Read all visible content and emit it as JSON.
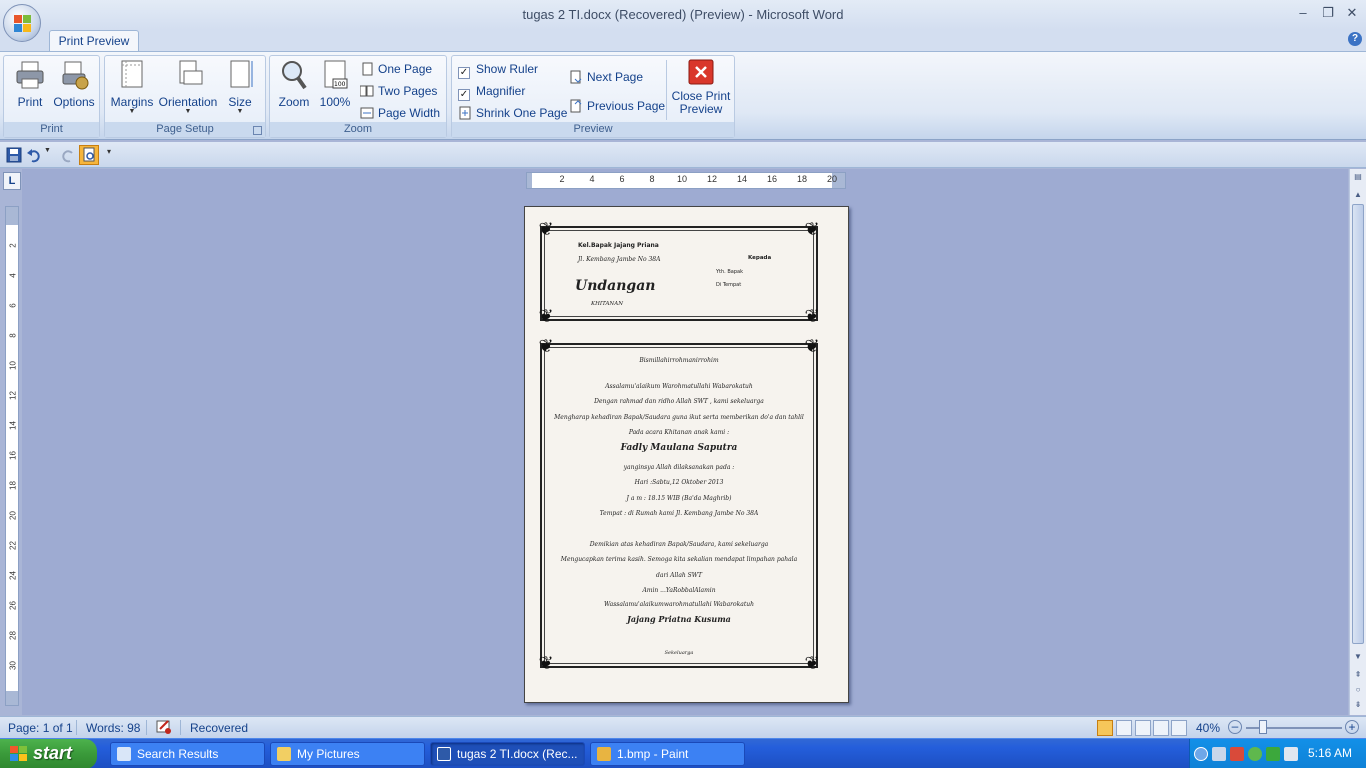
{
  "window": {
    "title": "tugas 2 TI.docx (Recovered) (Preview) - Microsoft Word",
    "minimize": "–",
    "maximize": "❐",
    "close": "✕"
  },
  "ribbon": {
    "active_tab": "Print Preview",
    "help": "?",
    "groups": {
      "print": {
        "label": "Print",
        "print_btn": "Print",
        "options_btn": "Options"
      },
      "page_setup": {
        "label": "Page Setup",
        "margins_btn": "Margins",
        "orientation_btn": "Orientation",
        "size_btn": "Size"
      },
      "zoom": {
        "label": "Zoom",
        "zoom_btn": "Zoom",
        "hundred_btn": "100%",
        "one_page": "One Page",
        "two_pages": "Two Pages",
        "page_width": "Page Width"
      },
      "preview": {
        "label": "Preview",
        "show_ruler": "Show Ruler",
        "magnifier": "Magnifier",
        "shrink_one_page": "Shrink One Page",
        "next_page": "Next Page",
        "previous_page": "Previous Page",
        "close_preview": "Close Print Preview",
        "show_ruler_checked": true,
        "magnifier_checked": true
      }
    }
  },
  "ruler": {
    "corner": "L",
    "h_ticks": [
      "2",
      "4",
      "6",
      "8",
      "10",
      "12",
      "14",
      "16",
      "18",
      "20"
    ],
    "v_ticks": [
      "2",
      "4",
      "6",
      "8",
      "10",
      "12",
      "14",
      "16",
      "18",
      "20",
      "22",
      "24",
      "26",
      "28",
      "30"
    ]
  },
  "document": {
    "envelope": {
      "sender_name": "Kel.Bapak Jajang Priana",
      "sender_addr": "Jl. Kembang Jambe No 38A",
      "recipient_label": "Kepada",
      "recipient_line1": "Yth. Bapak",
      "recipient_line2": "Di Tempat",
      "title": "Undangan",
      "subtitle": "KHITANAN"
    },
    "letter": {
      "line01": "Bismillahirrohmanirrohim",
      "line02": "Assalamu'alaikum Warohmatullahi Wabarokatuh",
      "line03": "Dengan rahmad dan ridho Allah SWT , kami sekeluarga",
      "line04": "Mengharap kehadiran Bapak/Saudara guna ikut serta memberikan do'a dan tahlil",
      "line05": "Pada acara Khitanan anak kami :",
      "child_name": "Fadly Maulana Saputra",
      "line06": "yanginsya Allah dilaksanakan pada :",
      "line07": "Hari :Sabtu,12 Oktober 2013",
      "line08": "J a m : 18.15 WIB (Ba'da Maghrib)",
      "line09": "Tempat : di Rumah kami Jl. Kembang Jambe No 38A",
      "line10": "Demikian atas kehadiran Bapak/Saudara, kami sekeluarga",
      "line11": "Mengucapkan terima kasih. Semoga kita sekalian mendapat limpahan pahala",
      "line12": "dari Allah SWT",
      "line13": "Amin ...YaRobbalAlamin",
      "line14": "Wassalamu'alaikumwarohmatullahi Wabarokatuh",
      "host_name": "Jajang Priatna Kusuma",
      "line15": "Sekeluarga"
    }
  },
  "status": {
    "page": "Page: 1 of 1",
    "words": "Words: 98",
    "recovered": "Recovered",
    "zoom": "40%"
  },
  "taskbar": {
    "start": "start",
    "tasks": [
      "Search Results",
      "My Pictures",
      "tugas 2 TI.docx (Rec...",
      "1.bmp - Paint"
    ],
    "clock": "5:16 AM"
  }
}
